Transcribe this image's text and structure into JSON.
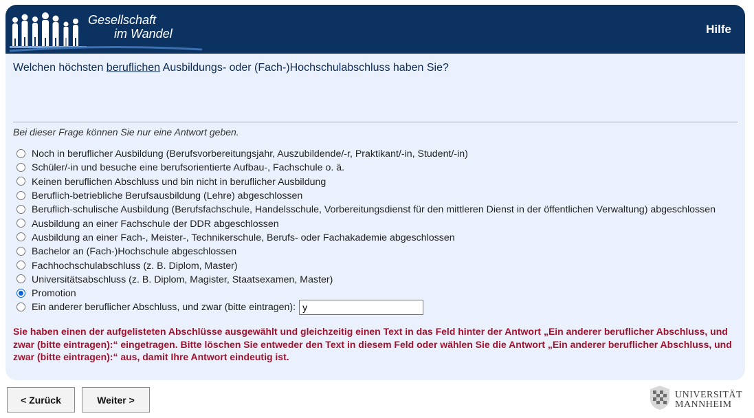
{
  "header": {
    "logo_line1": "Gesellschaft",
    "logo_line2": "im Wandel",
    "help_label": "Hilfe"
  },
  "question": {
    "prefix": "Welchen höchsten ",
    "emphasis": "beruflichen",
    "suffix": " Ausbildungs- oder (Fach-)Hochschulabschluss haben Sie?"
  },
  "instruction": "Bei dieser Frage können Sie nur eine Antwort geben.",
  "options": [
    {
      "label": "Noch in beruflicher Ausbildung (Berufsvorbereitungsjahr, Auszubildende/-r, Praktikant/-in, Student/-in)",
      "selected": false
    },
    {
      "label": "Schüler/-in und besuche eine berufsorientierte Aufbau-, Fachschule o. ä.",
      "selected": false
    },
    {
      "label": "Keinen beruflichen Abschluss und bin nicht in beruflicher Ausbildung",
      "selected": false
    },
    {
      "label": "Beruflich-betriebliche Berufsausbildung (Lehre) abgeschlossen",
      "selected": false
    },
    {
      "label": "Beruflich-schulische Ausbildung (Berufsfachschule, Handelsschule, Vorbereitungsdienst für den mittleren Dienst in der öffentlichen Verwaltung) abgeschlossen",
      "selected": false
    },
    {
      "label": "Ausbildung an einer Fachschule der DDR abgeschlossen",
      "selected": false
    },
    {
      "label": "Ausbildung an einer Fach-, Meister-, Technikerschule, Berufs- oder Fachakademie abgeschlossen",
      "selected": false
    },
    {
      "label": "Bachelor an (Fach-)Hochschule abgeschlossen",
      "selected": false
    },
    {
      "label": "Fachhochschulabschluss (z. B. Diplom, Master)",
      "selected": false
    },
    {
      "label": "Universitätsabschluss (z. B. Diplom, Magister, Staatsexamen, Master)",
      "selected": false
    },
    {
      "label": "Promotion",
      "selected": true
    },
    {
      "label": "Ein anderer beruflicher Abschluss, und zwar (bitte eintragen):",
      "selected": false,
      "text_value": "y"
    }
  ],
  "error_message": "Sie haben einen der aufgelisteten Abschlüsse ausgewählt und gleichzeitig einen Text in das Feld hinter der Antwort „Ein anderer beruflicher Abschluss, und zwar (bitte eintragen):“ eingetragen. Bitte löschen Sie entweder den Text in diesem Feld oder wählen Sie die Antwort „Ein anderer beruflicher Abschluss, und zwar (bitte eintragen):“ aus, damit Ihre Antwort eindeutig ist.",
  "nav": {
    "back_label": "< Zurück",
    "next_label": "Weiter >"
  },
  "university": {
    "line1": "UNIVERSITÄT",
    "line2": "MANNHEIM"
  },
  "colors": {
    "header_bg": "#0c3262",
    "panel_bg": "#eaf1fc",
    "error_text": "#a2122e",
    "radio_selected": "#0a62d8"
  }
}
